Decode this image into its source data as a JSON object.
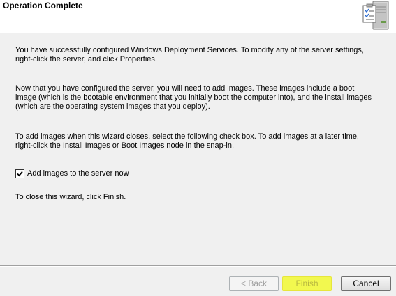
{
  "header": {
    "title": "Operation Complete",
    "icon": "server-checklist-icon"
  },
  "content": {
    "paragraph1": "You have successfully configured Windows Deployment Services. To modify any of the server settings, right-click the server, and click Properties.",
    "paragraph2": "Now that you have configured the server, you will need to add images. These images include a boot image (which is the bootable environment that you initially boot the computer into), and the install images (which are the operating system images that you deploy).",
    "paragraph3": "To add images when this wizard closes, select the following check box. To add images at a later time, right-click the Install Images or Boot Images node in the snap-in.",
    "checkbox": {
      "label": "Add images to the server now",
      "checked": true
    },
    "paragraph4": "To close this wizard, click Finish."
  },
  "footer": {
    "back_label": "< Back",
    "finish_label": "Finish",
    "cancel_label": "Cancel"
  },
  "colors": {
    "finish_highlight": "#f2f84f",
    "background": "#f0f0f0",
    "header_background": "#ffffff"
  }
}
